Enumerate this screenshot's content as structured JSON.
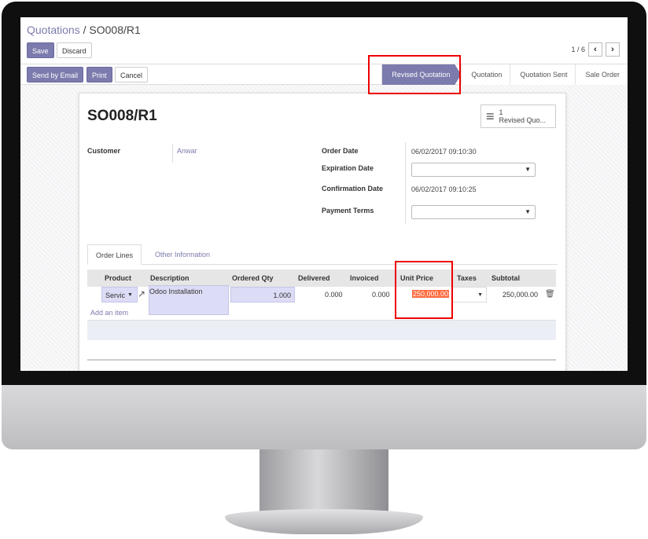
{
  "breadcrumb": {
    "parent": "Quotations",
    "separator": "/",
    "current": "SO008/R1"
  },
  "buttons": {
    "save": "Save",
    "discard": "Discard",
    "send_by_email": "Send by Email",
    "print": "Print",
    "cancel": "Cancel"
  },
  "pager": {
    "value": "1 / 6"
  },
  "status_stages": [
    "Revised Quotation",
    "Quotation",
    "Quotation Sent",
    "Sale Order"
  ],
  "active_stage": "Revised Quotation",
  "record": {
    "title": "SO008/R1",
    "smart_button": {
      "count": "1",
      "label": "Revised Quo..."
    }
  },
  "fields": {
    "customer_label": "Customer",
    "customer_value": "Anwar",
    "order_date_label": "Order Date",
    "order_date_value": "06/02/2017 09:10:30",
    "expiration_date_label": "Expiration Date",
    "expiration_date_value": "",
    "confirmation_date_label": "Confirmation Date",
    "confirmation_date_value": "06/02/2017 09:10:25",
    "payment_terms_label": "Payment Terms",
    "payment_terms_value": ""
  },
  "tabs": [
    "Order Lines",
    "Other Information"
  ],
  "order_lines": {
    "columns": [
      "Product",
      "Description",
      "Ordered Qty",
      "Delivered",
      "Invoiced",
      "Unit Price",
      "Taxes",
      "Subtotal"
    ],
    "rows": [
      {
        "product": "Servic",
        "description": "Odoo Installation",
        "ordered_qty": "1.000",
        "delivered": "0.000",
        "invoiced": "0.000",
        "unit_price": "250,000.00",
        "taxes": "",
        "subtotal": "250,000.00"
      }
    ],
    "add_item": "Add an item"
  },
  "colors": {
    "primary": "#7c7bad",
    "highlight": "#ee0000",
    "selection": "#ff6a3d"
  },
  "icons": [
    "external-link-icon",
    "trash-icon",
    "hamburger-list-icon",
    "chevron-left-icon",
    "chevron-right-icon",
    "caret-down-icon"
  ]
}
